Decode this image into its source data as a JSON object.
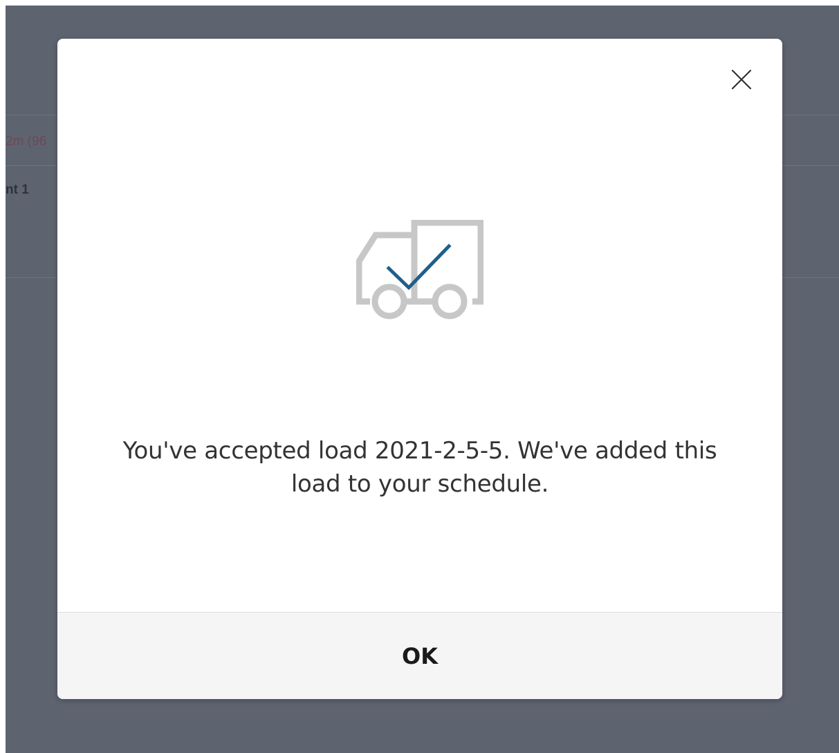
{
  "background": {
    "duration_fragment": "2m (96",
    "name_fragment": "nt 1"
  },
  "modal": {
    "icon": "truck-check-icon",
    "message": "You've accepted load 2021-2-5-5. We've added this load to your schedule.",
    "ok_label": "OK",
    "close_icon": "close-icon"
  },
  "colors": {
    "overlay": "#5e6370",
    "check_accent": "#1f5f8b",
    "truck_gray": "#c7c7c7",
    "footer_bg": "#f5f5f5"
  }
}
